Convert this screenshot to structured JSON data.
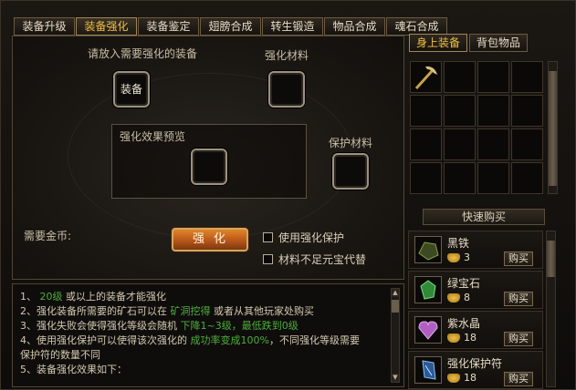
{
  "tabs": [
    "装备升级",
    "装备强化",
    "装备鉴定",
    "翅膀合成",
    "转生锻造",
    "物品合成",
    "魂石合成"
  ],
  "active_tab": "装备强化",
  "main": {
    "equip_prompt": "请放入需要强化的装备",
    "material_label": "强化材料",
    "equip_slot_text": "装备",
    "preview_label": "强化效果预览",
    "protect_label": "保护材料",
    "gold_label": "需要金币:",
    "strengthen_button": "强化",
    "check_protect": "使用强化保护",
    "check_yuanbao": "材料不足元宝代替"
  },
  "info": {
    "line1_prefix": "1、 ",
    "line1_green": "20级",
    "line1_suffix": " 或以上的装备才能强化",
    "line2_prefix": "2、强化装备所需要的矿石可以在 ",
    "line2_green": "矿洞挖得",
    "line2_suffix": " 或者从其他玩家处购买",
    "line3_prefix": "3、强化失败会使得强化等级会随机 ",
    "line3_green": "下降1~3级，最低跌到0级",
    "line4_prefix": "4、使用强化保护可以使得该次强化的 ",
    "line4_green": "成功率变成100%",
    "line4_suffix": "，不同强化等级需要",
    "line4b": "保护符的数量不同",
    "line5": "5、装备强化效果如下："
  },
  "right_tabs": [
    "身上装备",
    "背包物品"
  ],
  "active_right_tab": "身上装备",
  "quick_buy": "快速购买",
  "shop": [
    {
      "name": "黑铁",
      "price": "3",
      "buy": "购买",
      "icon": "black-iron-ore-icon",
      "color": "#4a5a2a"
    },
    {
      "name": "绿宝石",
      "price": "8",
      "buy": "购买",
      "icon": "emerald-icon",
      "color": "#2f8a3a"
    },
    {
      "name": "紫水晶",
      "price": "18",
      "buy": "购买",
      "icon": "amethyst-icon",
      "color": "#b060c0"
    },
    {
      "name": "强化保护符",
      "price": "18",
      "buy": "购买",
      "icon": "protection-charm-icon",
      "color": "#3a70b0"
    }
  ]
}
